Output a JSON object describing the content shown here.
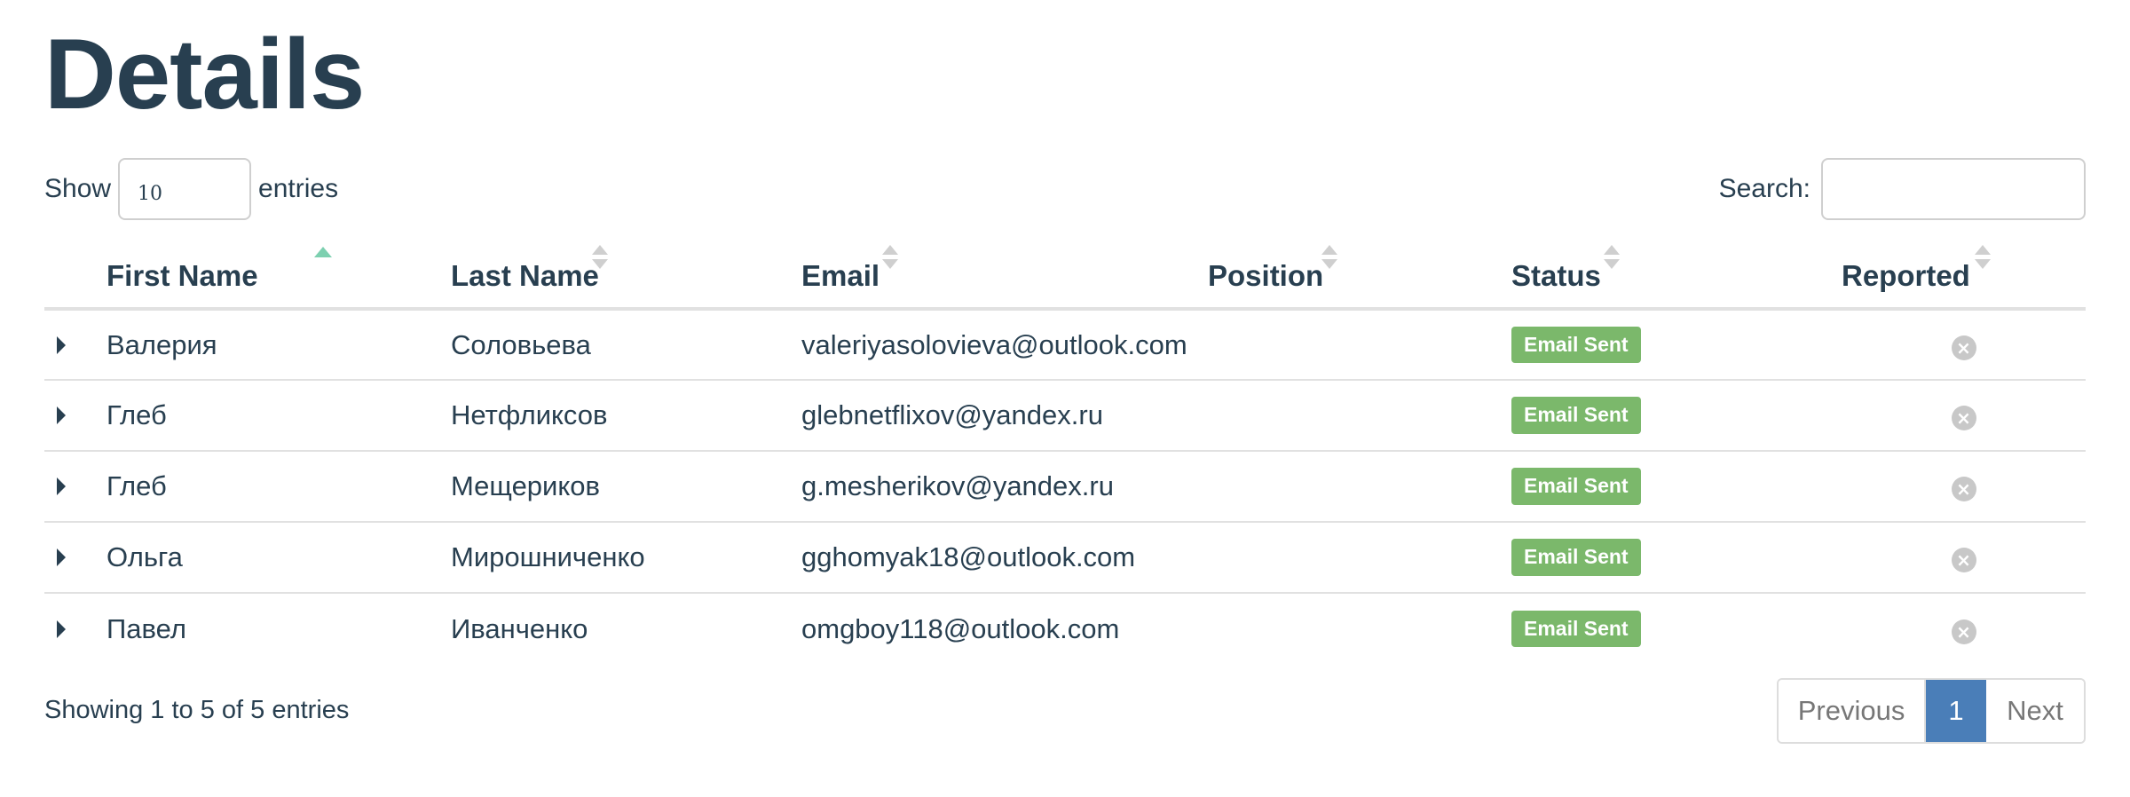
{
  "page": {
    "title": "Details"
  },
  "controls": {
    "show_label": "Show",
    "entries_label": "entries",
    "length_value": "10",
    "search_label": "Search:",
    "search_value": ""
  },
  "table": {
    "columns": [
      "First Name",
      "Last Name",
      "Email",
      "Position",
      "Status",
      "Reported"
    ],
    "sorted_column": "First Name",
    "sort_direction": "ascending",
    "rows": [
      {
        "first": "Валерия",
        "last": "Соловьева",
        "email": "valeriyasolovieva@outlook.com",
        "position": "",
        "status": "Email Sent",
        "reported": "x-circle-icon"
      },
      {
        "first": "Глеб",
        "last": "Нетфликсов",
        "email": "glebnetflixov@yandex.ru",
        "position": "",
        "status": "Email Sent",
        "reported": "x-circle-icon"
      },
      {
        "first": "Глеб",
        "last": "Мещериков",
        "email": "g.mesherikov@yandex.ru",
        "position": "",
        "status": "Email Sent",
        "reported": "x-circle-icon"
      },
      {
        "first": "Ольга",
        "last": "Мирошниченко",
        "email": "gghomyak18@outlook.com",
        "position": "",
        "status": "Email Sent",
        "reported": "x-circle-icon"
      },
      {
        "first": "Павел",
        "last": "Иванченко",
        "email": "omgboy118@outlook.com",
        "position": "",
        "status": "Email Sent",
        "reported": "x-circle-icon"
      }
    ]
  },
  "footer": {
    "info": "Showing 1 to 5 of 5 entries",
    "previous": "Previous",
    "current_page": "1",
    "next": "Next"
  },
  "colors": {
    "title": "#283f50",
    "status_badge": "#7bb86b",
    "active_page": "#4a7eb8",
    "sort_active": "#7dd0b0"
  }
}
